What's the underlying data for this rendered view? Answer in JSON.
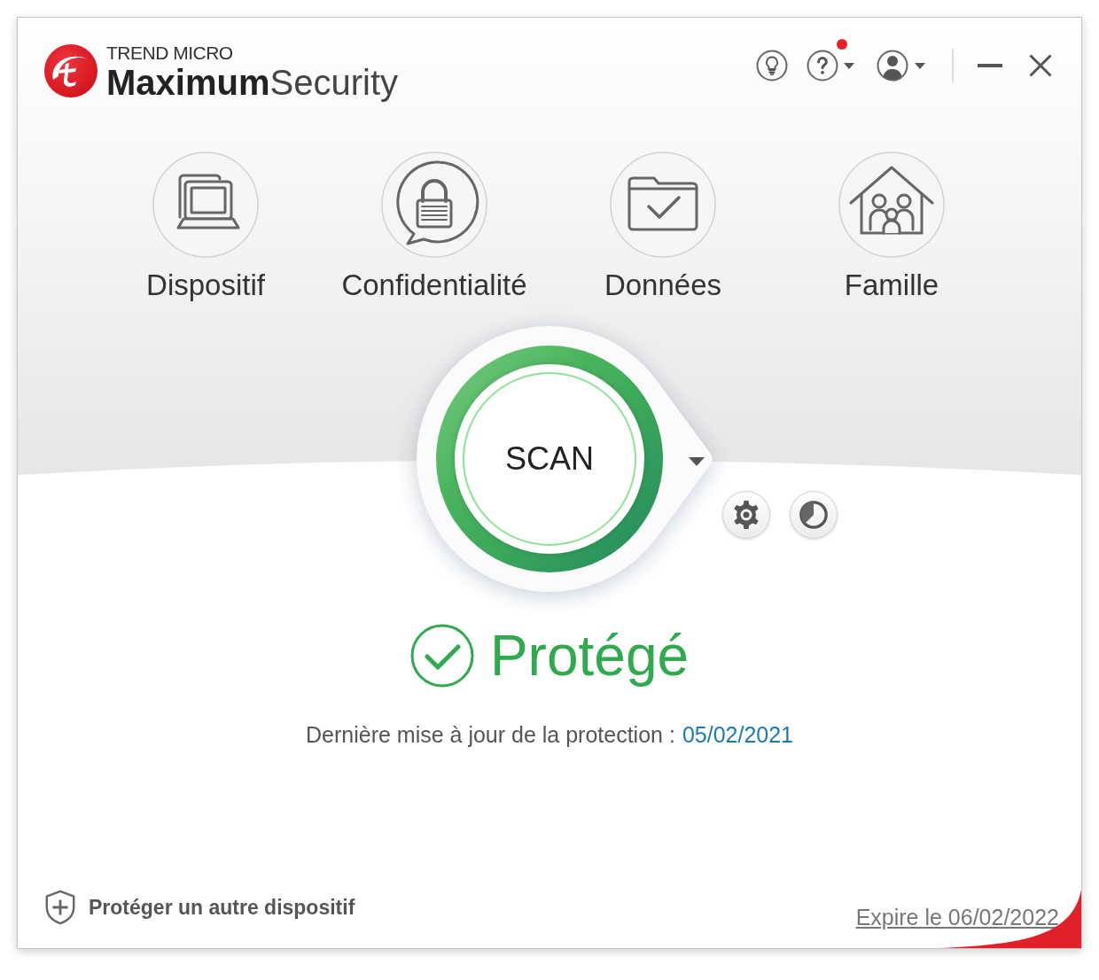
{
  "brand": {
    "company": "TREND MICRO",
    "product": "**Maximum**Security"
  },
  "header": {
    "help_notification": true
  },
  "features": [
    {
      "kind": "device",
      "label": "Dispositif"
    },
    {
      "kind": "privacy",
      "label": "Confidentialité"
    },
    {
      "kind": "data",
      "label": "Données"
    },
    {
      "kind": "family",
      "label": "Famille"
    }
  ],
  "scan": {
    "label": "SCAN"
  },
  "status": {
    "label": "Protégé",
    "protected": true
  },
  "last_update": {
    "label": "Dernière mise à jour de la protection :",
    "date": "05/02/2021"
  },
  "footer": {
    "protect_link": "Protéger un autre dispositif",
    "expiry_link": "Expire le 06/02/2022"
  }
}
